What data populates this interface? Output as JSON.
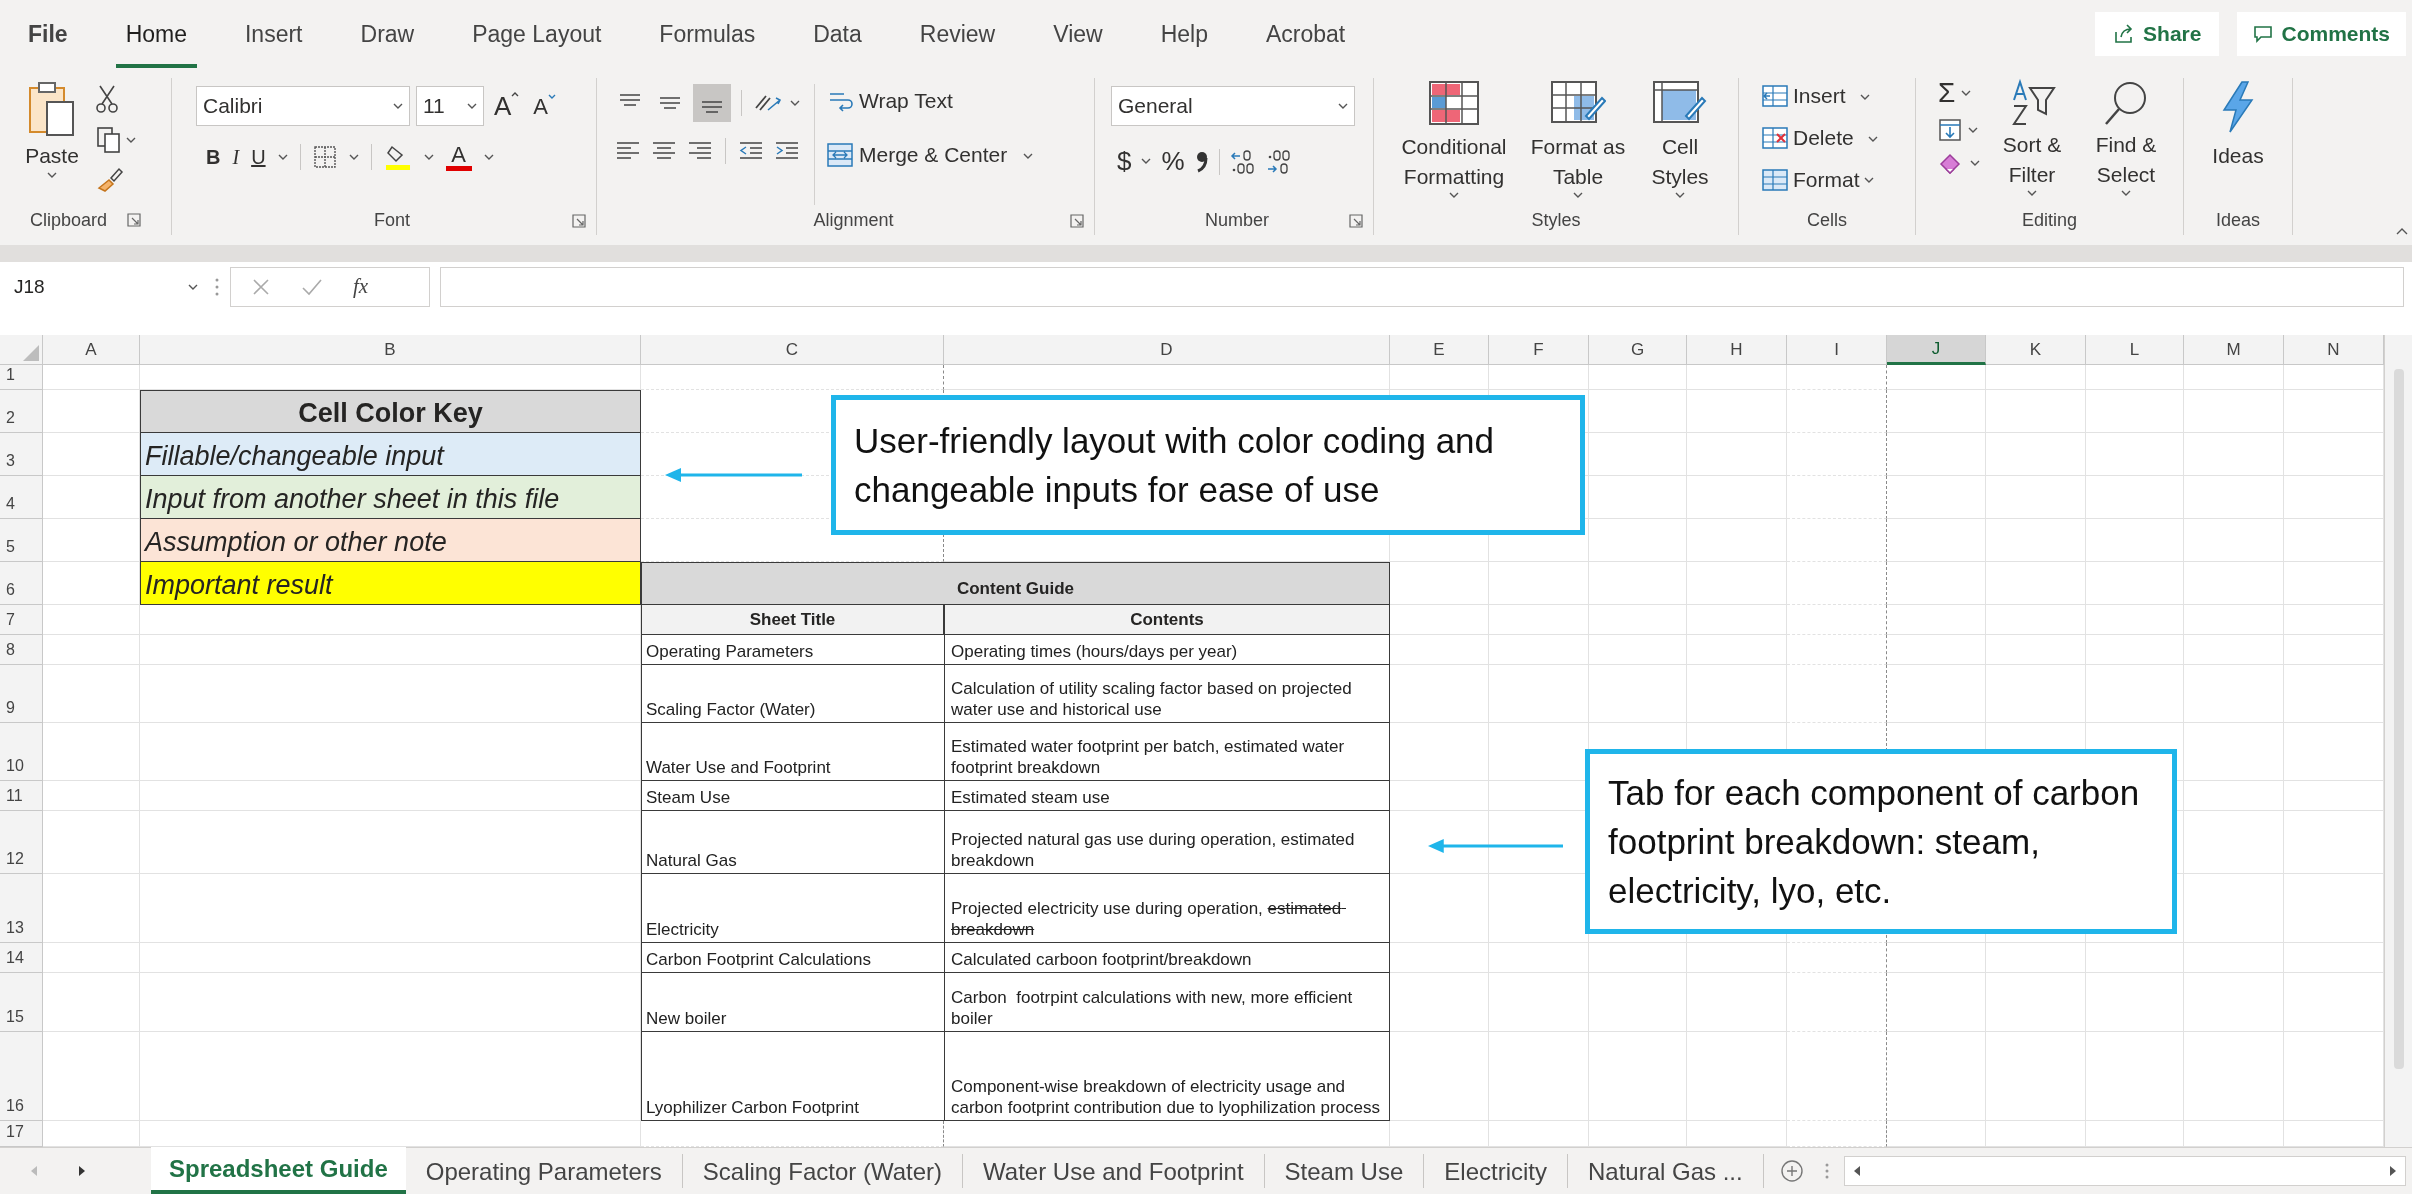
{
  "menu_tabs": [
    {
      "label": "File",
      "selected": false
    },
    {
      "label": "Home",
      "selected": true
    },
    {
      "label": "Insert",
      "selected": false
    },
    {
      "label": "Draw",
      "selected": false
    },
    {
      "label": "Page Layout",
      "selected": false
    },
    {
      "label": "Formulas",
      "selected": false
    },
    {
      "label": "Data",
      "selected": false
    },
    {
      "label": "Review",
      "selected": false
    },
    {
      "label": "View",
      "selected": false
    },
    {
      "label": "Help",
      "selected": false
    },
    {
      "label": "Acrobat",
      "selected": false
    }
  ],
  "share_button": "Share",
  "comments_button": "Comments",
  "ribbon": {
    "clipboard": {
      "paste": "Paste",
      "label": "Clipboard"
    },
    "font": {
      "font_name": "Calibri",
      "font_size": "11",
      "grow_font": "A",
      "shrink_font": "A",
      "bold": "B",
      "italic": "I",
      "underline": "U",
      "font_color": "A",
      "label": "Font"
    },
    "alignment": {
      "wrap_text": "Wrap Text",
      "merge_center": "Merge & Center",
      "label": "Alignment"
    },
    "number": {
      "format": "General",
      "currency": "$",
      "percent": "%",
      "label": "Number"
    },
    "styles": {
      "conditional_formatting": "Conditional Formatting",
      "format_as_table": "Format as Table",
      "cell_styles": "Cell Styles",
      "label": "Styles"
    },
    "cells": {
      "insert": "Insert",
      "delete": "Delete",
      "format": "Format",
      "label": "Cells"
    },
    "editing": {
      "autosum": "Σ",
      "sort_filter": "Sort & Filter",
      "find_select": "Find & Select",
      "label": "Editing"
    },
    "ideas": {
      "ideas": "Ideas",
      "label": "Ideas"
    }
  },
  "formula_bar": {
    "name_box": "J18",
    "function": "fx"
  },
  "column_headers": [
    {
      "label": "A",
      "selected": false
    },
    {
      "label": "B",
      "selected": false
    },
    {
      "label": "C",
      "selected": false
    },
    {
      "label": "D",
      "selected": false
    },
    {
      "label": "E",
      "selected": false
    },
    {
      "label": "F",
      "selected": false
    },
    {
      "label": "G",
      "selected": false
    },
    {
      "label": "H",
      "selected": false
    },
    {
      "label": "I",
      "selected": false
    },
    {
      "label": "J",
      "selected": true
    },
    {
      "label": "K",
      "selected": false
    },
    {
      "label": "L",
      "selected": false
    },
    {
      "label": "M",
      "selected": false
    },
    {
      "label": "N",
      "selected": false
    }
  ],
  "row_headers": [
    "1",
    "2",
    "3",
    "4",
    "5",
    "6",
    "7",
    "8",
    "9",
    "10",
    "11",
    "12",
    "13",
    "14",
    "15",
    "16",
    "17"
  ],
  "color_key": {
    "title": "Cell Color Key",
    "items": [
      {
        "label": "Fillable/changeable input",
        "color": "#ddebf7"
      },
      {
        "label": "Input from another sheet in this file",
        "color": "#e2efda"
      },
      {
        "label": "Assumption or other note",
        "color": "#fce4d6"
      },
      {
        "label": "Important result",
        "color": "#ffff00"
      }
    ]
  },
  "content_guide": {
    "title": "Content Guide",
    "columns": [
      "Sheet Title",
      "Contents"
    ],
    "rows": [
      {
        "sheet": "Operating Parameters",
        "contents": [
          {
            "text": "Operating times (hours/days per year)",
            "strikethrough": false
          }
        ]
      },
      {
        "sheet": "Scaling Factor (Water)",
        "contents": [
          {
            "text": "Calculation of utility scaling factor based on projected water use and historical use",
            "strikethrough": false
          }
        ]
      },
      {
        "sheet": "Water Use and Footprint",
        "contents": [
          {
            "text": "Estimated water footprint per batch, estimated water footprint breakdown",
            "strikethrough": false
          }
        ]
      },
      {
        "sheet": "Steam Use",
        "contents": [
          {
            "text": "Estimated steam use",
            "strikethrough": false
          }
        ]
      },
      {
        "sheet": "Natural Gas",
        "contents": [
          {
            "text": "Projected natural gas use during operation, estimated breakdown",
            "strikethrough": false
          }
        ]
      },
      {
        "sheet": "Electricity",
        "contents": [
          {
            "text": "Projected electricity use during operation, ",
            "strikethrough": false
          },
          {
            "text": "estimated breakdown",
            "strikethrough": true
          }
        ]
      },
      {
        "sheet": "Carbon Footprint Calculations",
        "contents": [
          {
            "text": "Calculated carboon footprint/breakdown",
            "strikethrough": false
          }
        ]
      },
      {
        "sheet": "New boiler",
        "contents": [
          {
            "text": "Carbon  footrpint calculations with new, more efficient boiler",
            "strikethrough": false
          }
        ]
      },
      {
        "sheet": "Lyophilizer Carbon Footprint",
        "contents": [
          {
            "text": "Component-wise breakdown of electricity usage and carbon footprint contribution due to lyophilization process",
            "strikethrough": false
          }
        ]
      }
    ]
  },
  "callouts": [
    {
      "text": "User-friendly layout with color coding and changeable inputs for ease of use"
    },
    {
      "text": "Tab for each component of carbon footprint breakdown: steam, electricity, lyo, etc."
    }
  ],
  "sheet_tabs": [
    {
      "label": "Spreadsheet Guide",
      "selected": true
    },
    {
      "label": "Operating Parameters",
      "selected": false
    },
    {
      "label": "Scaling Factor (Water)",
      "selected": false
    },
    {
      "label": "Water Use and Footprint",
      "selected": false
    },
    {
      "label": "Steam Use",
      "selected": false
    },
    {
      "label": "Electricity",
      "selected": false
    },
    {
      "label": "Natural Gas ...",
      "selected": false
    }
  ]
}
